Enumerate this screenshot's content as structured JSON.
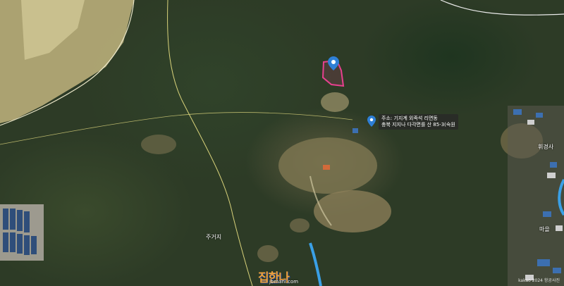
{
  "map": {
    "callout_line1": "주소: 기지계 외족석 리면동",
    "callout_line2": "충북 지지나 다각면를 산 85-3(숙원",
    "place_labels": [
      {
        "name": "label-facility-1",
        "text": "휘경사"
      },
      {
        "name": "label-village",
        "text": "마을"
      },
      {
        "name": "label-residence",
        "text": "주거지"
      }
    ],
    "logo": {
      "main": "집한나",
      "sub": "jbmani.com"
    },
    "copyright": "kakao 2024 항공사진",
    "colors": {
      "parcel": "#e8408f",
      "marker": "#2e7fd6",
      "stream": "#3aa0e6",
      "road_line": "#d8d27a"
    }
  }
}
